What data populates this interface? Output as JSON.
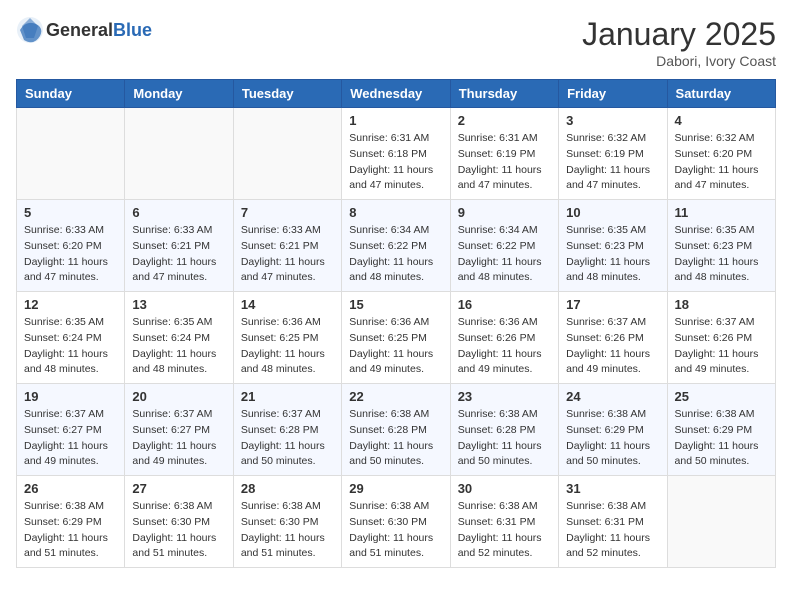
{
  "header": {
    "logo_general": "General",
    "logo_blue": "Blue",
    "month": "January 2025",
    "location": "Dabori, Ivory Coast"
  },
  "days_of_week": [
    "Sunday",
    "Monday",
    "Tuesday",
    "Wednesday",
    "Thursday",
    "Friday",
    "Saturday"
  ],
  "weeks": [
    [
      {
        "day": "",
        "sunrise": "",
        "sunset": "",
        "daylight": ""
      },
      {
        "day": "",
        "sunrise": "",
        "sunset": "",
        "daylight": ""
      },
      {
        "day": "",
        "sunrise": "",
        "sunset": "",
        "daylight": ""
      },
      {
        "day": "1",
        "sunrise": "Sunrise: 6:31 AM",
        "sunset": "Sunset: 6:18 PM",
        "daylight": "Daylight: 11 hours and 47 minutes."
      },
      {
        "day": "2",
        "sunrise": "Sunrise: 6:31 AM",
        "sunset": "Sunset: 6:19 PM",
        "daylight": "Daylight: 11 hours and 47 minutes."
      },
      {
        "day": "3",
        "sunrise": "Sunrise: 6:32 AM",
        "sunset": "Sunset: 6:19 PM",
        "daylight": "Daylight: 11 hours and 47 minutes."
      },
      {
        "day": "4",
        "sunrise": "Sunrise: 6:32 AM",
        "sunset": "Sunset: 6:20 PM",
        "daylight": "Daylight: 11 hours and 47 minutes."
      }
    ],
    [
      {
        "day": "5",
        "sunrise": "Sunrise: 6:33 AM",
        "sunset": "Sunset: 6:20 PM",
        "daylight": "Daylight: 11 hours and 47 minutes."
      },
      {
        "day": "6",
        "sunrise": "Sunrise: 6:33 AM",
        "sunset": "Sunset: 6:21 PM",
        "daylight": "Daylight: 11 hours and 47 minutes."
      },
      {
        "day": "7",
        "sunrise": "Sunrise: 6:33 AM",
        "sunset": "Sunset: 6:21 PM",
        "daylight": "Daylight: 11 hours and 47 minutes."
      },
      {
        "day": "8",
        "sunrise": "Sunrise: 6:34 AM",
        "sunset": "Sunset: 6:22 PM",
        "daylight": "Daylight: 11 hours and 48 minutes."
      },
      {
        "day": "9",
        "sunrise": "Sunrise: 6:34 AM",
        "sunset": "Sunset: 6:22 PM",
        "daylight": "Daylight: 11 hours and 48 minutes."
      },
      {
        "day": "10",
        "sunrise": "Sunrise: 6:35 AM",
        "sunset": "Sunset: 6:23 PM",
        "daylight": "Daylight: 11 hours and 48 minutes."
      },
      {
        "day": "11",
        "sunrise": "Sunrise: 6:35 AM",
        "sunset": "Sunset: 6:23 PM",
        "daylight": "Daylight: 11 hours and 48 minutes."
      }
    ],
    [
      {
        "day": "12",
        "sunrise": "Sunrise: 6:35 AM",
        "sunset": "Sunset: 6:24 PM",
        "daylight": "Daylight: 11 hours and 48 minutes."
      },
      {
        "day": "13",
        "sunrise": "Sunrise: 6:35 AM",
        "sunset": "Sunset: 6:24 PM",
        "daylight": "Daylight: 11 hours and 48 minutes."
      },
      {
        "day": "14",
        "sunrise": "Sunrise: 6:36 AM",
        "sunset": "Sunset: 6:25 PM",
        "daylight": "Daylight: 11 hours and 48 minutes."
      },
      {
        "day": "15",
        "sunrise": "Sunrise: 6:36 AM",
        "sunset": "Sunset: 6:25 PM",
        "daylight": "Daylight: 11 hours and 49 minutes."
      },
      {
        "day": "16",
        "sunrise": "Sunrise: 6:36 AM",
        "sunset": "Sunset: 6:26 PM",
        "daylight": "Daylight: 11 hours and 49 minutes."
      },
      {
        "day": "17",
        "sunrise": "Sunrise: 6:37 AM",
        "sunset": "Sunset: 6:26 PM",
        "daylight": "Daylight: 11 hours and 49 minutes."
      },
      {
        "day": "18",
        "sunrise": "Sunrise: 6:37 AM",
        "sunset": "Sunset: 6:26 PM",
        "daylight": "Daylight: 11 hours and 49 minutes."
      }
    ],
    [
      {
        "day": "19",
        "sunrise": "Sunrise: 6:37 AM",
        "sunset": "Sunset: 6:27 PM",
        "daylight": "Daylight: 11 hours and 49 minutes."
      },
      {
        "day": "20",
        "sunrise": "Sunrise: 6:37 AM",
        "sunset": "Sunset: 6:27 PM",
        "daylight": "Daylight: 11 hours and 49 minutes."
      },
      {
        "day": "21",
        "sunrise": "Sunrise: 6:37 AM",
        "sunset": "Sunset: 6:28 PM",
        "daylight": "Daylight: 11 hours and 50 minutes."
      },
      {
        "day": "22",
        "sunrise": "Sunrise: 6:38 AM",
        "sunset": "Sunset: 6:28 PM",
        "daylight": "Daylight: 11 hours and 50 minutes."
      },
      {
        "day": "23",
        "sunrise": "Sunrise: 6:38 AM",
        "sunset": "Sunset: 6:28 PM",
        "daylight": "Daylight: 11 hours and 50 minutes."
      },
      {
        "day": "24",
        "sunrise": "Sunrise: 6:38 AM",
        "sunset": "Sunset: 6:29 PM",
        "daylight": "Daylight: 11 hours and 50 minutes."
      },
      {
        "day": "25",
        "sunrise": "Sunrise: 6:38 AM",
        "sunset": "Sunset: 6:29 PM",
        "daylight": "Daylight: 11 hours and 50 minutes."
      }
    ],
    [
      {
        "day": "26",
        "sunrise": "Sunrise: 6:38 AM",
        "sunset": "Sunset: 6:29 PM",
        "daylight": "Daylight: 11 hours and 51 minutes."
      },
      {
        "day": "27",
        "sunrise": "Sunrise: 6:38 AM",
        "sunset": "Sunset: 6:30 PM",
        "daylight": "Daylight: 11 hours and 51 minutes."
      },
      {
        "day": "28",
        "sunrise": "Sunrise: 6:38 AM",
        "sunset": "Sunset: 6:30 PM",
        "daylight": "Daylight: 11 hours and 51 minutes."
      },
      {
        "day": "29",
        "sunrise": "Sunrise: 6:38 AM",
        "sunset": "Sunset: 6:30 PM",
        "daylight": "Daylight: 11 hours and 51 minutes."
      },
      {
        "day": "30",
        "sunrise": "Sunrise: 6:38 AM",
        "sunset": "Sunset: 6:31 PM",
        "daylight": "Daylight: 11 hours and 52 minutes."
      },
      {
        "day": "31",
        "sunrise": "Sunrise: 6:38 AM",
        "sunset": "Sunset: 6:31 PM",
        "daylight": "Daylight: 11 hours and 52 minutes."
      },
      {
        "day": "",
        "sunrise": "",
        "sunset": "",
        "daylight": ""
      }
    ]
  ]
}
